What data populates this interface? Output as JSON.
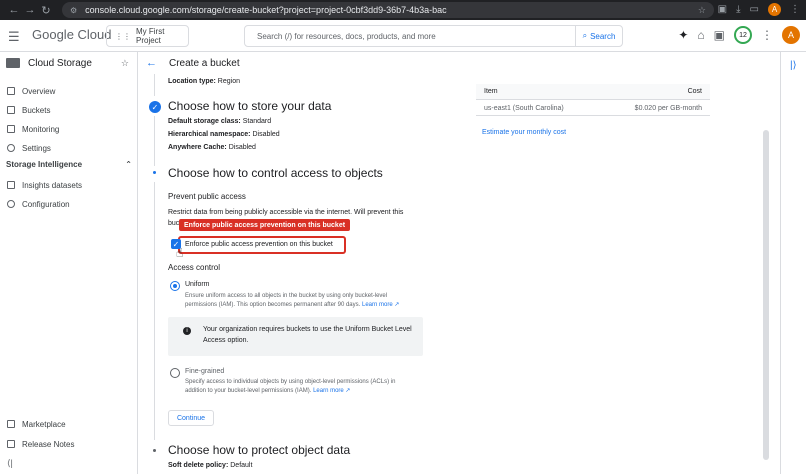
{
  "browser": {
    "url": "console.cloud.google.com/storage/create-bucket?project=project-0cbf3dd9-36b7-4b3a-bac",
    "profile_initial": "A"
  },
  "header": {
    "logo_text": "Google Cloud",
    "project_label": "My First Project",
    "search_placeholder": "Search (/) for resources, docs, products, and more",
    "search_button": "Search",
    "notifications_count": "12",
    "avatar_initial": "A"
  },
  "sidebar": {
    "title": "Cloud Storage",
    "items": [
      {
        "label": "Overview",
        "icon": "overview-icon"
      },
      {
        "label": "Buckets",
        "icon": "bucket-icon"
      },
      {
        "label": "Monitoring",
        "icon": "chart-icon"
      },
      {
        "label": "Settings",
        "icon": "gear-icon"
      }
    ],
    "section_label": "Storage Intelligence",
    "section_items": [
      {
        "label": "Insights datasets",
        "icon": "dataset-icon"
      },
      {
        "label": "Configuration",
        "icon": "config-icon"
      }
    ],
    "bottom_items": [
      {
        "label": "Marketplace",
        "icon": "marketplace-icon"
      },
      {
        "label": "Release Notes",
        "icon": "notes-icon"
      }
    ]
  },
  "page": {
    "title": "Create a bucket",
    "location_type_label": "Location type:",
    "location_type_value": "Region",
    "step_store": {
      "heading": "Choose how to store your data",
      "storage_class_label": "Default storage class:",
      "storage_class_value": "Standard",
      "namespace_label": "Hierarchical namespace:",
      "namespace_value": "Disabled",
      "cache_label": "Anywhere Cache:",
      "cache_value": "Disabled"
    },
    "step_access": {
      "heading": "Choose how to control access to objects",
      "prevent_heading": "Prevent public access",
      "prevent_desc_line1": "Restrict data from being publicly accessible via the internet. Will prevent this",
      "prevent_desc_line2": "buc",
      "tooltip": "Enforce public access prevention on this bucket",
      "checkbox_label": "Enforce public access prevention on this bucket",
      "checkbox_checked": true,
      "access_control_heading": "Access control",
      "uniform_label": "Uniform",
      "uniform_desc_line1": "Ensure uniform access to all objects in the bucket by using only bucket-level",
      "uniform_desc_line2": "permissions (IAM). This option becomes permanent after 90 days.",
      "learn_more": "Learn more",
      "info_text": "Your organization requires buckets to use the Uniform Bucket Level Access option.",
      "fine_label": "Fine-grained",
      "fine_desc_line1": "Specify access to individual objects by using object-level permissions (ACLs) in",
      "fine_desc_line2": "addition to your bucket-level permissions (IAM).",
      "continue": "Continue",
      "selected_option": "Uniform"
    },
    "step_protect": {
      "heading": "Choose how to protect object data",
      "soft_delete_label": "Soft delete policy:",
      "soft_delete_value": "Default"
    }
  },
  "summary": {
    "col_item": "Item",
    "col_cost": "Cost",
    "row_item": "us-east1 (South Carolina)",
    "row_cost": "$0.020 per GB-month",
    "estimate_link": "Estimate your monthly cost"
  },
  "colors": {
    "accent": "#1a73e8",
    "highlight": "#d93025"
  }
}
